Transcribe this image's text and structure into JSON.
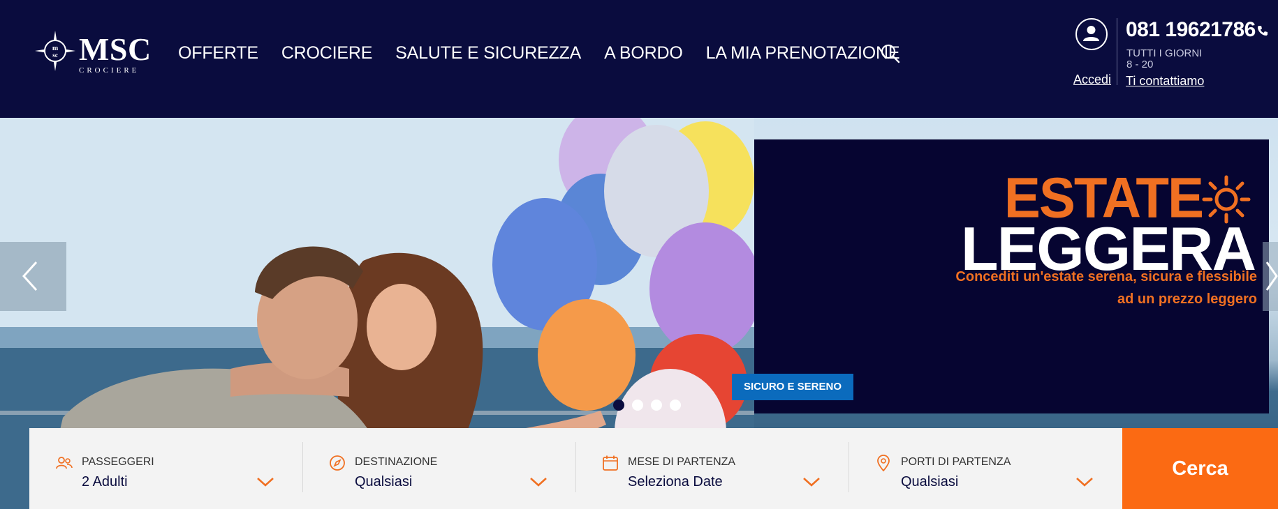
{
  "brand": {
    "logo_text": "MSC",
    "logo_subtext": "CROCIERE"
  },
  "nav": {
    "items": [
      {
        "label": "OFFERTE"
      },
      {
        "label": "CROCIERE"
      },
      {
        "label": "SALUTE E SICUREZZA"
      },
      {
        "label": "A BORDO"
      },
      {
        "label": "LA MIA PRENOTAZIONE"
      }
    ]
  },
  "account": {
    "login_label": "Accedi"
  },
  "contact": {
    "phone": "081 19621786",
    "hours_line1": "TUTTI I GIORNI",
    "hours_line2": "8 - 20",
    "contact_label": "Ti contattiamo"
  },
  "hero": {
    "promo_title_line1": "ESTATE",
    "promo_title_line2": "LEGGERA",
    "promo_subtitle_line1": "Concediti un'estate serena, sicura e flessibile",
    "promo_subtitle_line2": "ad un prezzo leggero",
    "badge": "SICURO E SERENO",
    "slides_count": 4,
    "active_slide": 1
  },
  "search": {
    "fields": [
      {
        "label": "PASSEGGERI",
        "value": "2 Adulti",
        "icon": "people-icon"
      },
      {
        "label": "DESTINAZIONE",
        "value": "Qualsiasi",
        "icon": "compass-icon"
      },
      {
        "label": "MESE DI PARTENZA",
        "value": "Seleziona Date",
        "icon": "calendar-icon"
      },
      {
        "label": "PORTI DI PARTENZA",
        "value": "Qualsiasi",
        "icon": "location-pin-icon"
      }
    ],
    "submit_label": "Cerca"
  },
  "colors": {
    "header_bg": "#0a0c3e",
    "accent_orange": "#fb6a13",
    "badge_blue": "#0b6bbd",
    "panel_bg": "#060531"
  }
}
